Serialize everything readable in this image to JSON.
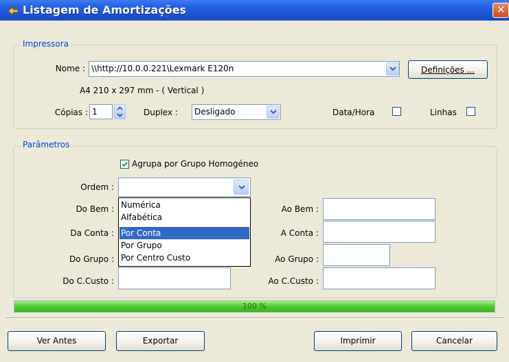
{
  "window": {
    "title": "Listagem de Amortizações"
  },
  "impressora": {
    "legend": "Impressora",
    "nome_label": "Nome :",
    "nome_value": "\\\\http://10.0.0.221\\Lexmark E120n",
    "definicoes_label": "Definições ...",
    "paper_info": "A4 210 x 297 mm  -  ( Vertical )",
    "copias_label": "Cópias :",
    "copias_value": "1",
    "duplex_label": "Duplex :",
    "duplex_value": "Desligado",
    "datahora_label": "Data/Hora",
    "datahora_checked": false,
    "linhas_label": "Linhas",
    "linhas_checked": false
  },
  "parametros": {
    "legend": "Parâmetros",
    "agrupa_label": "Agrupa por Grupo Homogéneo",
    "agrupa_checked": true,
    "ordem_label": "Ordem :",
    "ordem_value": "",
    "ordem_options": [
      "Numérica",
      "Alfabética",
      "Por Conta",
      "Por Grupo",
      "Por Centro Custo"
    ],
    "ordem_highlighted": "Por Conta",
    "do_bem_label": "Do Bem :",
    "ao_bem_label": "Ao Bem :",
    "da_conta_label": "Da Conta :",
    "a_conta_label": "A Conta :",
    "do_grupo_label": "Do Grupo :",
    "ao_grupo_label": "Ao Grupo :",
    "do_ccusto_label": "Do C.Custo :",
    "ao_ccusto_label": "Ao C.Custo :"
  },
  "progress": {
    "value": 1.0,
    "text": "100 %"
  },
  "buttons": {
    "ver_antes": "Ver Antes",
    "exportar": "Exportar",
    "imprimir": "Imprimir",
    "cancelar": "Cancelar"
  },
  "colors": {
    "titlebar": "#2563e6",
    "legend": "#0046d5",
    "selection": "#316ac5",
    "progress": "#4ec92e"
  },
  "icons": {
    "title": "report-arrow-icon",
    "close": "close-icon",
    "dropdown": "chevron-down-icon",
    "spin": "spin-updown-icon",
    "check": "checkmark-icon"
  }
}
